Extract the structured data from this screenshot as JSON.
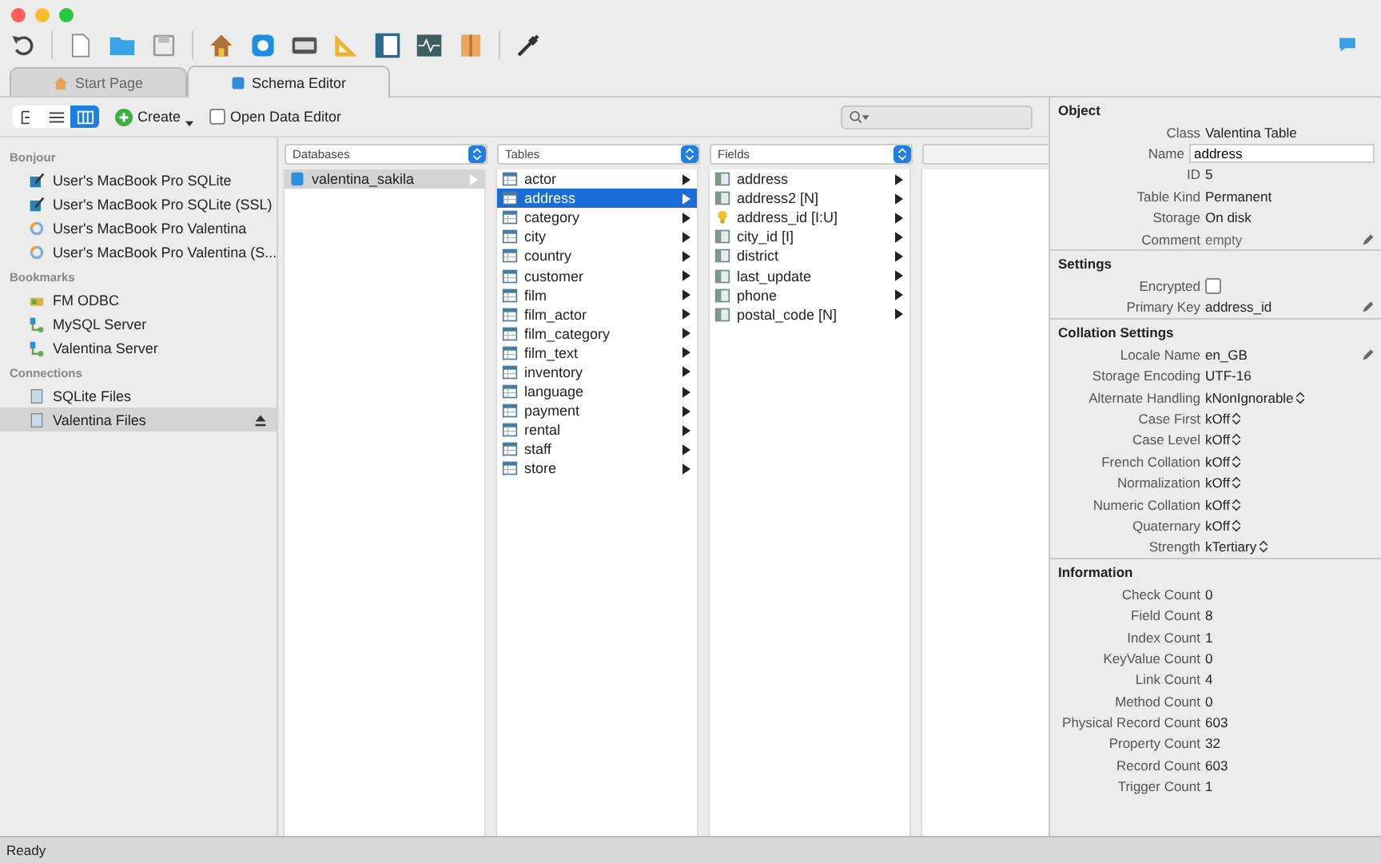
{
  "tabs": [
    {
      "label": "Start Page",
      "selected": false
    },
    {
      "label": "Schema Editor",
      "selected": true
    }
  ],
  "view_modes": [
    {
      "selected": false
    },
    {
      "selected": false
    },
    {
      "selected": true
    }
  ],
  "create_button": "Create",
  "open_data_editor": {
    "label": "Open Data Editor",
    "checked": false
  },
  "sidebar": {
    "sections": [
      {
        "title": "Bonjour",
        "items": [
          {
            "label": "User's MacBook Pro SQLite",
            "kind": "sqlite",
            "selected": false
          },
          {
            "label": "User's MacBook Pro SQLite (SSL)",
            "kind": "sqlite",
            "selected": false
          },
          {
            "label": "User's MacBook Pro Valentina",
            "kind": "valentina",
            "selected": false
          },
          {
            "label": "User's MacBook Pro Valentina (S...",
            "kind": "valentina",
            "selected": false
          }
        ]
      },
      {
        "title": "Bookmarks",
        "items": [
          {
            "label": "FM ODBC",
            "kind": "odbc",
            "selected": false
          },
          {
            "label": "MySQL Server",
            "kind": "server",
            "selected": false
          },
          {
            "label": "Valentina Server",
            "kind": "server",
            "selected": false
          }
        ]
      },
      {
        "title": "Connections",
        "items": [
          {
            "label": "SQLite Files",
            "kind": "file",
            "selected": false
          },
          {
            "label": "Valentina Files",
            "kind": "file",
            "selected": true,
            "eject": true
          }
        ]
      }
    ]
  },
  "columns": [
    {
      "header": "Databases",
      "items": [
        {
          "label": "valentina_sakila",
          "selected": true
        }
      ]
    },
    {
      "header": "Tables",
      "items": [
        {
          "label": "actor",
          "selected": false
        },
        {
          "label": "address",
          "selected": true
        },
        {
          "label": "category",
          "selected": false
        },
        {
          "label": "city",
          "selected": false
        },
        {
          "label": "country",
          "selected": false
        },
        {
          "label": "customer",
          "selected": false
        },
        {
          "label": "film",
          "selected": false
        },
        {
          "label": "film_actor",
          "selected": false
        },
        {
          "label": "film_category",
          "selected": false
        },
        {
          "label": "film_text",
          "selected": false
        },
        {
          "label": "inventory",
          "selected": false
        },
        {
          "label": "language",
          "selected": false
        },
        {
          "label": "payment",
          "selected": false
        },
        {
          "label": "rental",
          "selected": false
        },
        {
          "label": "staff",
          "selected": false
        },
        {
          "label": "store",
          "selected": false
        }
      ]
    },
    {
      "header": "Fields",
      "items": [
        {
          "label": "address",
          "kind": "field",
          "selected": false
        },
        {
          "label": "address2 [N]",
          "kind": "field",
          "selected": false
        },
        {
          "label": "address_id [I:U]",
          "kind": "key",
          "selected": false
        },
        {
          "label": "city_id [I]",
          "kind": "field",
          "selected": false
        },
        {
          "label": "district",
          "kind": "field",
          "selected": false
        },
        {
          "label": "last_update",
          "kind": "field",
          "selected": false
        },
        {
          "label": "phone",
          "kind": "field",
          "selected": false
        },
        {
          "label": "postal_code [N]",
          "kind": "field",
          "selected": false
        }
      ]
    }
  ],
  "inspector": [
    {
      "title": "Object",
      "rows": [
        {
          "label": "Class",
          "value": "Valentina Table",
          "kind": "text"
        },
        {
          "label": "Name",
          "value": "address",
          "kind": "field"
        },
        {
          "label": "ID",
          "value": "5",
          "kind": "text"
        },
        {
          "label": "Table Kind",
          "value": "Permanent",
          "kind": "text"
        },
        {
          "label": "Storage",
          "value": "On disk",
          "kind": "text"
        },
        {
          "label": "Comment",
          "value": "empty",
          "kind": "text",
          "editable": true,
          "dim": true
        }
      ]
    },
    {
      "title": "Settings",
      "rows": [
        {
          "label": "Encrypted",
          "kind": "checkbox",
          "checked": false
        },
        {
          "label": "Primary Key",
          "value": "address_id",
          "kind": "text",
          "editable": true
        }
      ]
    },
    {
      "title": "Collation Settings",
      "rows": [
        {
          "label": "Locale Name",
          "value": "en_GB",
          "kind": "text",
          "editable": true
        },
        {
          "label": "Storage Encoding",
          "value": "UTF-16",
          "kind": "text"
        },
        {
          "label": "Alternate Handling",
          "value": "kNonIgnorable",
          "kind": "popup"
        },
        {
          "label": "Case First",
          "value": "kOff",
          "kind": "popup"
        },
        {
          "label": "Case Level",
          "value": "kOff",
          "kind": "popup"
        },
        {
          "label": "French Collation",
          "value": "kOff",
          "kind": "popup"
        },
        {
          "label": "Normalization",
          "value": "kOff",
          "kind": "popup"
        },
        {
          "label": "Numeric Collation",
          "value": "kOff",
          "kind": "popup"
        },
        {
          "label": "Quaternary",
          "value": "kOff",
          "kind": "popup"
        },
        {
          "label": "Strength",
          "value": "kTertiary",
          "kind": "popup"
        }
      ]
    },
    {
      "title": "Information",
      "rows": [
        {
          "label": "Check Count",
          "value": "0",
          "kind": "text"
        },
        {
          "label": "Field Count",
          "value": "8",
          "kind": "text"
        },
        {
          "label": "Index Count",
          "value": "1",
          "kind": "text"
        },
        {
          "label": "KeyValue Count",
          "value": "0",
          "kind": "text"
        },
        {
          "label": "Link Count",
          "value": "4",
          "kind": "text"
        },
        {
          "label": "Method Count",
          "value": "0",
          "kind": "text"
        },
        {
          "label": "Physical Record Count",
          "value": "603",
          "kind": "text"
        },
        {
          "label": "Property Count",
          "value": "32",
          "kind": "text"
        },
        {
          "label": "Record Count",
          "value": "603",
          "kind": "text"
        },
        {
          "label": "Trigger Count",
          "value": "1",
          "kind": "text"
        }
      ]
    }
  ],
  "status_bar": "Ready"
}
